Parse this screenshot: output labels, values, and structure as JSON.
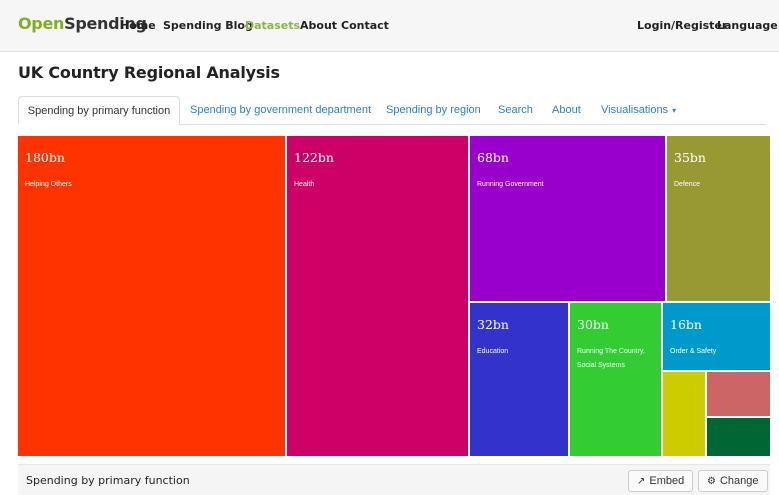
{
  "nav": {
    "brand_part1": "Open",
    "brand_part2": "Spending",
    "home": "Home",
    "blog": "Spending Blog",
    "datasets": "Datasets",
    "about": "About",
    "contact": "Contact",
    "login": "Login/Register",
    "language": "Language"
  },
  "page": {
    "title": "UK Country Regional Analysis"
  },
  "tabs": {
    "primary_function": "Spending by primary function",
    "department": "Spending by government department",
    "region": "Spending by region",
    "search": "Search",
    "about": "About",
    "visualisations": "Visualisations",
    "visualisations_caret": "▾"
  },
  "treemap": {
    "cells": [
      {
        "value": "180bn",
        "label": "Helping Others",
        "color": "#ff3300"
      },
      {
        "value": "122bn",
        "label": "Health",
        "color": "#cc0066"
      },
      {
        "value": "68bn",
        "label": "Running Government",
        "color": "#9900cc"
      },
      {
        "value": "35bn",
        "label": "Defence",
        "color": "#999933"
      },
      {
        "value": "32bn",
        "label": "Education",
        "color": "#3333cc"
      },
      {
        "value": "30bn",
        "label": "Running The Country, Social Systems",
        "color": "#33cc33"
      },
      {
        "value": "16bn",
        "label": "Order & Safety",
        "color": "#0099cc"
      },
      {
        "value": "",
        "label": "",
        "color": "#cccc00"
      },
      {
        "value": "",
        "label": "",
        "color": "#cc6666"
      },
      {
        "value": "",
        "label": "",
        "color": "#006633"
      }
    ]
  },
  "footer": {
    "title": "Spending by primary function",
    "embed_icon": "↗",
    "embed_label": "Embed",
    "change_icon": "⚙",
    "change_label": "Change"
  }
}
